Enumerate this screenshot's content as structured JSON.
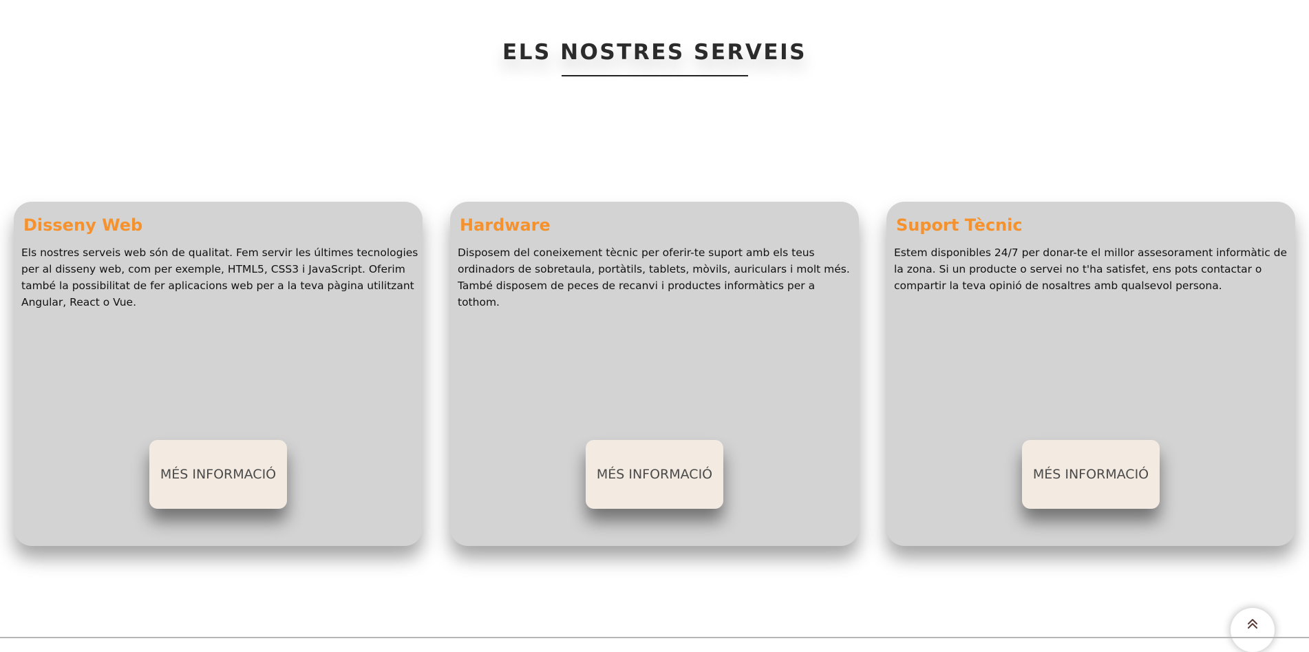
{
  "section": {
    "title": "ELS NOSTRES SERVEIS"
  },
  "colors": {
    "card_title": "#f5922e",
    "card_background": "#d3d3d3",
    "button_background": "#f3ebe2"
  },
  "cards": [
    {
      "title": "Disseny Web",
      "text": "Els nostres serveis web són de qualitat. Fem servir les últimes tecnologies per al disseny web, com per exemple, HTML5, CSS3 i JavaScript. Oferim també la possibilitat de fer aplicacions web per a la teva pàgina utilitzant Angular, React o Vue.",
      "button_label": "MÉS INFORMACIÓ"
    },
    {
      "title": "Hardware",
      "text": "Disposem del coneixement tècnic per oferir-te suport amb els teus ordinadors de sobretaula, portàtils, tablets, mòvils, auriculars i molt més. També disposem de peces de recanvi i productes informàtics per a tothom.",
      "button_label": "MÉS INFORMACIÓ"
    },
    {
      "title": "Suport Tècnic",
      "text": "Estem disponibles 24/7 per donar-te el millor assesorament informàtic de la zona. Si un producte o servei no t'ha satisfet, ens pots contactar o compartir la teva opinió de nosaltres amb qualsevol persona.",
      "button_label": "MÉS INFORMACIÓ"
    }
  ],
  "scroll_top": {
    "icon": "double-chevron-up-icon"
  }
}
